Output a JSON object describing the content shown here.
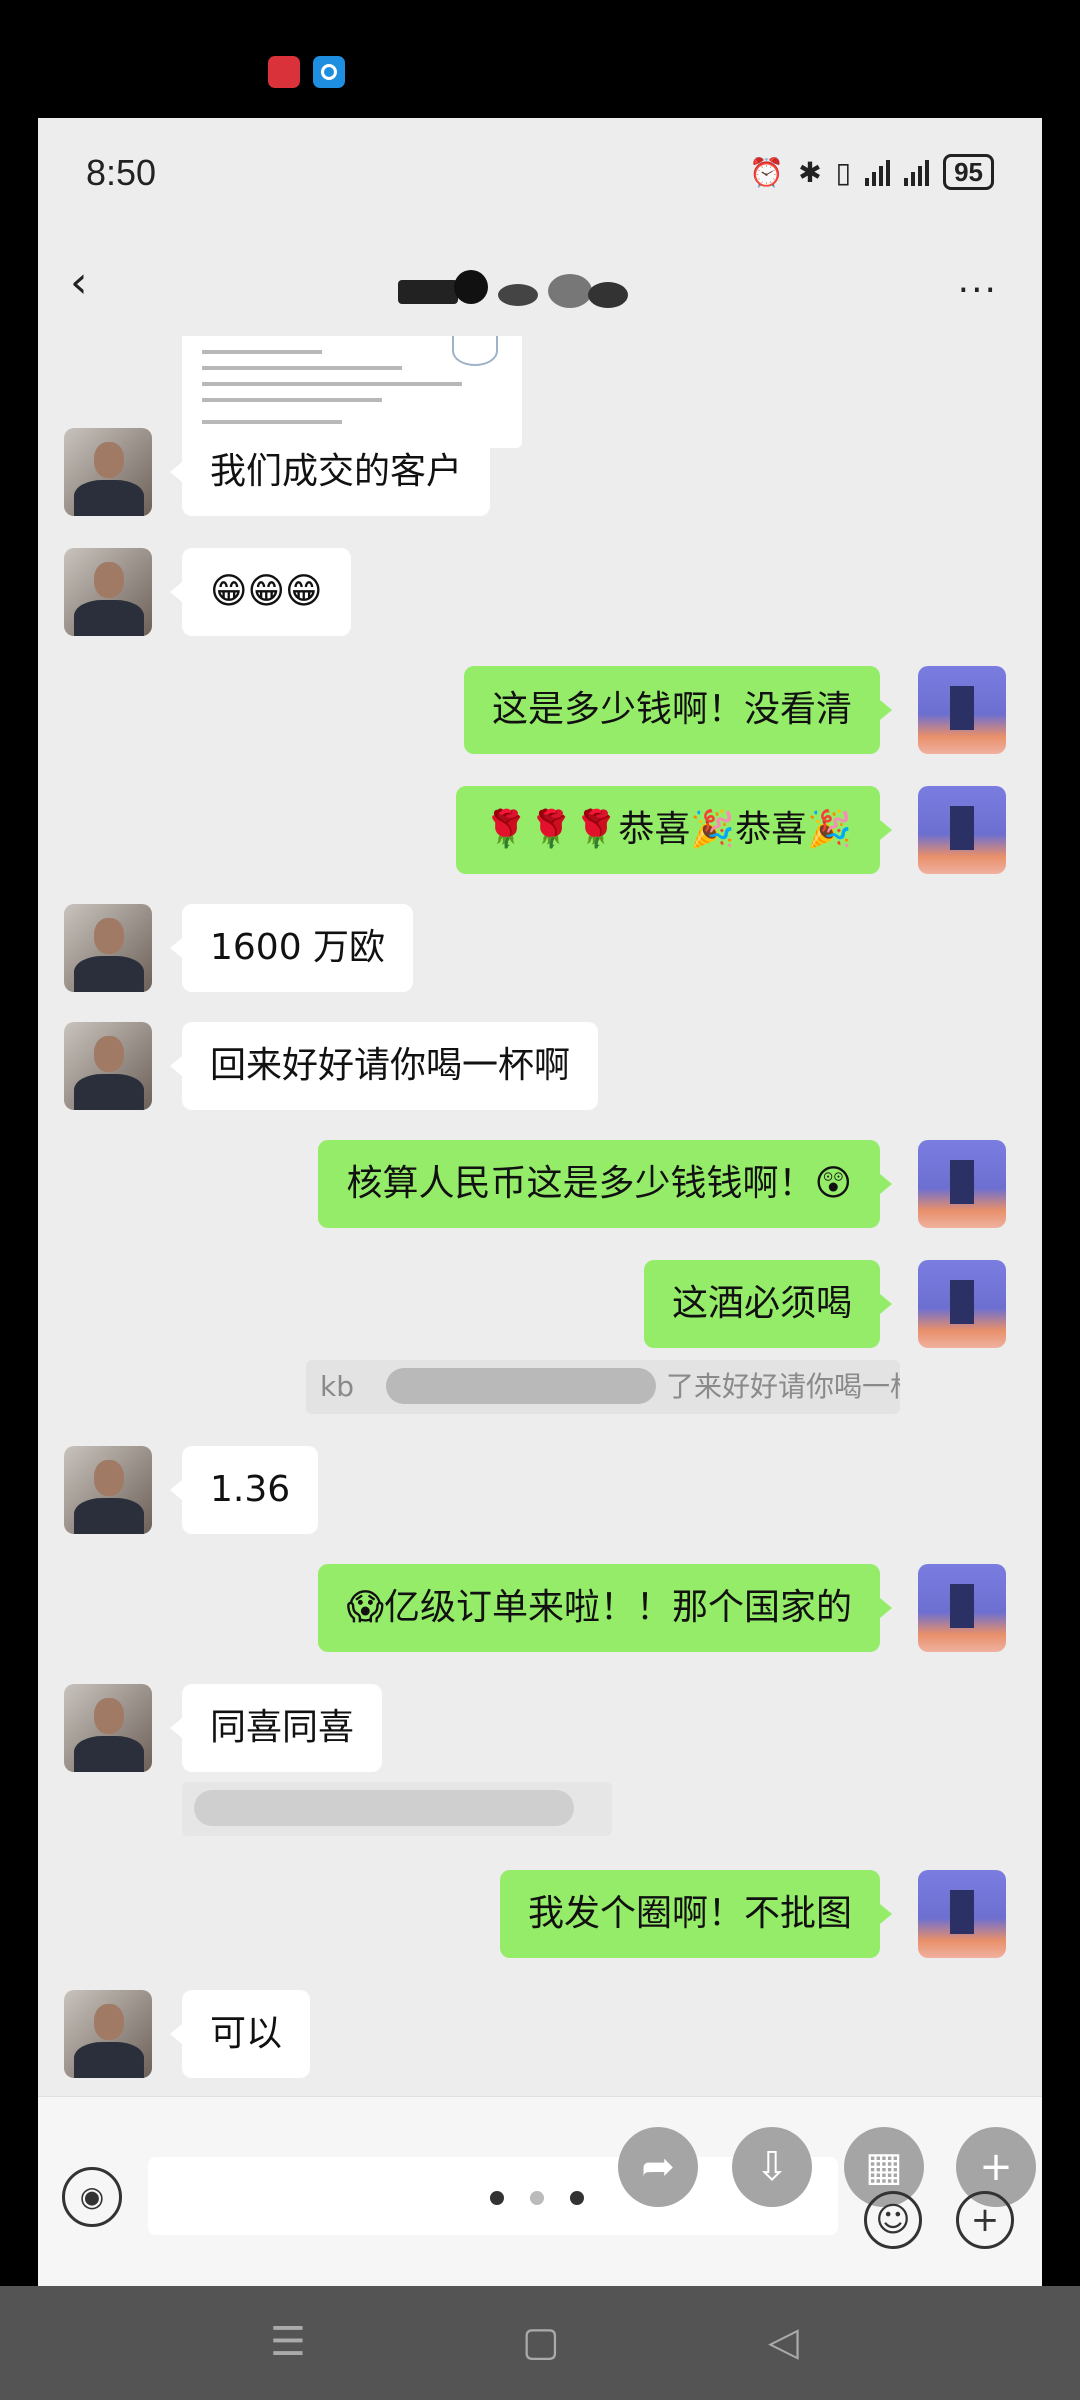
{
  "status_bar": {
    "time": "8:50",
    "battery": "95"
  },
  "header": {
    "back_glyph": "‹",
    "more_glyph": "···"
  },
  "messages": [
    {
      "side": "left",
      "text": "我们成交的客户"
    },
    {
      "side": "left",
      "text": "😁😁😁"
    },
    {
      "side": "right",
      "text": "这是多少钱啊！没看清"
    },
    {
      "side": "right",
      "text": "🌹🌹🌹恭喜🎉恭喜🎉"
    },
    {
      "side": "left",
      "text": "1600 万欧"
    },
    {
      "side": "left",
      "text": "回来好好请你喝一杯啊"
    },
    {
      "side": "right",
      "text": "核算人民币这是多少钱钱啊！😲"
    },
    {
      "side": "right",
      "text": "这酒必须喝"
    },
    {
      "side": "quote",
      "text": "kb",
      "tail": "了来好好请你喝一杯啊"
    },
    {
      "side": "left",
      "text": "1.36"
    },
    {
      "side": "right",
      "text": "😱亿级订单来啦！！那个国家的"
    },
    {
      "side": "left",
      "text": "同喜同喜"
    },
    {
      "side": "right",
      "text": "我发个圈啊！不批图"
    },
    {
      "side": "left",
      "text": "可以"
    }
  ],
  "input_bar": {
    "voice_icon": "◉",
    "plus_icon": "+",
    "emoji_icon": "☺",
    "pager": {
      "pages": 3,
      "current": 1
    }
  },
  "colors": {
    "sent_bubble": "#95ec69",
    "received_bubble": "#ffffff",
    "chat_background": "#ededed"
  }
}
